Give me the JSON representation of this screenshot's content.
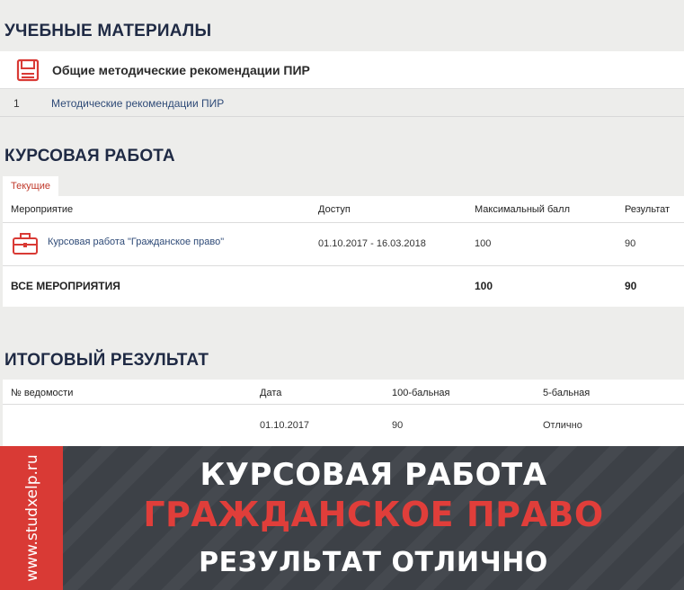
{
  "materials": {
    "title": "УЧЕБНЫЕ МАТЕРИАЛЫ",
    "card_label": "Общие методические рекомендации ПИР",
    "items": [
      {
        "num": "1",
        "label": "Методические рекомендации ПИР"
      }
    ]
  },
  "coursework": {
    "title": "КУРСОВАЯ РАБОТА",
    "tab": "Текущие",
    "headers": {
      "event": "Мероприятие",
      "access": "Доступ",
      "max": "Максимальный балл",
      "result": "Результат"
    },
    "row": {
      "event": "Курсовая работа \"Гражданское право\"",
      "access": "01.10.2017 - 16.03.2018",
      "max": "100",
      "result": "90"
    },
    "total": {
      "label": "ВСЕ МЕРОПРИЯТИЯ",
      "max": "100",
      "result": "90"
    }
  },
  "final": {
    "title": "ИТОГОВЫЙ РЕЗУЛЬТАТ",
    "headers": {
      "number": "№ ведомости",
      "date": "Дата",
      "score100": "100-бальная",
      "score5": "5-бальная"
    },
    "row": {
      "date": "01.10.2017",
      "score100": "90",
      "score5": "Отлично"
    }
  },
  "banner": {
    "site": "www.studxelp.ru",
    "line1": "КУРСОВАЯ РАБОТА",
    "line2": "ГРАЖДАНСКОЕ ПРАВО",
    "line3": "РЕЗУЛЬТАТ ОТЛИЧНО"
  },
  "colors": {
    "accent": "#d93a35",
    "navy": "#1f2a44",
    "link": "#2e4a77",
    "banner_bg": "#3d4147"
  }
}
